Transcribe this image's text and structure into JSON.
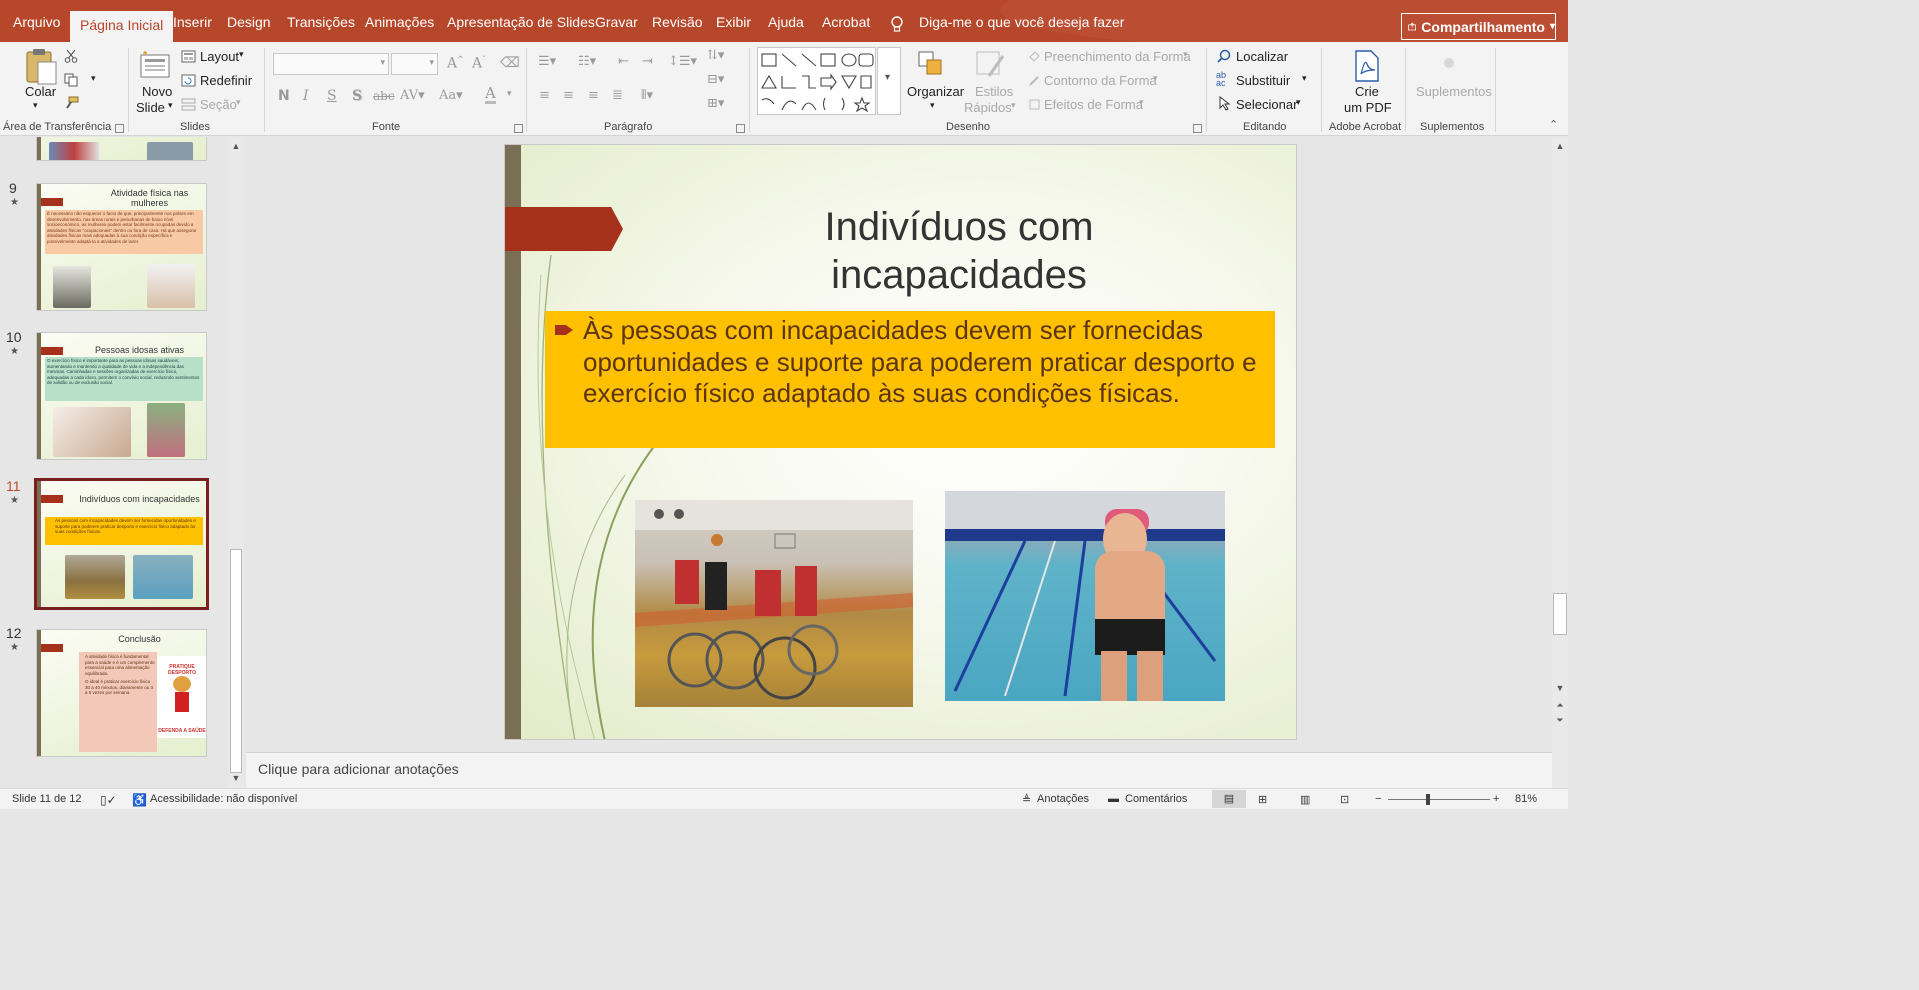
{
  "tabs": [
    "Arquivo",
    "Página Inicial",
    "Inserir",
    "Design",
    "Transições",
    "Animações",
    "Apresentação de Slides",
    "Gravar",
    "Revisão",
    "Exibir",
    "Ajuda",
    "Acrobat"
  ],
  "active_tab": "Página Inicial",
  "tell_me": "Diga-me o que você deseja fazer",
  "share_label": "Compartilhamento",
  "ribbon": {
    "clipboard": {
      "paste": "Colar",
      "label": "Área de Transferência"
    },
    "slides": {
      "new_slide_1": "Novo",
      "new_slide_2": "Slide",
      "layout": "Layout",
      "reset": "Redefinir",
      "section": "Seção",
      "label": "Slides"
    },
    "font": {
      "label": "Fonte"
    },
    "paragraph": {
      "label": "Parágrafo"
    },
    "drawing": {
      "arrange": "Organizar",
      "quick_styles_1": "Estilos",
      "quick_styles_2": "Rápidos",
      "fill": "Preenchimento da Forma",
      "outline": "Contorno da Forma",
      "effects": "Efeitos de Forma",
      "label": "Desenho"
    },
    "editing": {
      "find": "Localizar",
      "replace": "Substituir",
      "select": "Selecionar",
      "label": "Editando"
    },
    "acrobat": {
      "create_1": "Crie",
      "create_2": "um PDF",
      "label": "Adobe Acrobat"
    },
    "addins": {
      "addins_btn": "Suplementos",
      "label": "Suplementos"
    }
  },
  "thumbnails": [
    {
      "num": "9",
      "title": "Atividade física nas mulheres",
      "text": "É necessário não esquecer o facto de que, principalmente nos países em desenvolvimento, nas áreas rurais e periurbanas de baixo nível socioeconómico, as mulheres podem estar facilmente ocupadas devido a atividades físicas \"ocupacionais\" dentro ou fora de casa. Há que assegurar atividades físicas mais adequadas à sua condição específica e possivelmente adaptá-la a atividades de lazer."
    },
    {
      "num": "10",
      "title": "Pessoas idosas ativas",
      "text": "O exercício físico é importante para as pessoas idosas saudáveis, aumentando e mantendo a qualidade de vida e a independência das mesmas. Caminhadas e sessões organizadas de exercício físico, adequadas a cada idoso, permitem o convívio social, reduzindo sentimentos de solidão ou de exclusão social."
    },
    {
      "num": "11",
      "title": "Indivíduos com incapacidades",
      "text": "Às pessoas com incapacidades devem ser fornecidas oportunidades e suporte para poderem praticar desporto e exercício físico adaptado às suas condições físicas."
    },
    {
      "num": "12",
      "title": "Conclusão",
      "bullets": [
        "A atividade física é fundamental para a saúde e é um complemento essencial para uma alimentação equilibrada.",
        "O ideal é praticar exercício físico 30 a 40 minutos, diariamente ou 3 a 5 vezes por semana."
      ],
      "sign_top": "PRATIQUE DESPORTO",
      "sign_bottom": "DEFENDA A SAÚDE"
    }
  ],
  "slide": {
    "title_line1": "Indivíduos com",
    "title_line2": "incapacidades",
    "body": "Às pessoas com incapacidades devem ser fornecidas oportunidades e suporte para poderem praticar desporto e exercício físico adaptado às suas condições físicas."
  },
  "notes_placeholder": "Clique para adicionar anotações",
  "status": {
    "slide_counter": "Slide 11 de 12",
    "accessibility": "Acessibilidade: não disponível",
    "notes": "Anotações",
    "comments": "Comentários",
    "zoom": "81%"
  },
  "colors": {
    "accent": "#b7472a",
    "slide_flag": "#a6311a",
    "body_box": "#ffc000"
  }
}
